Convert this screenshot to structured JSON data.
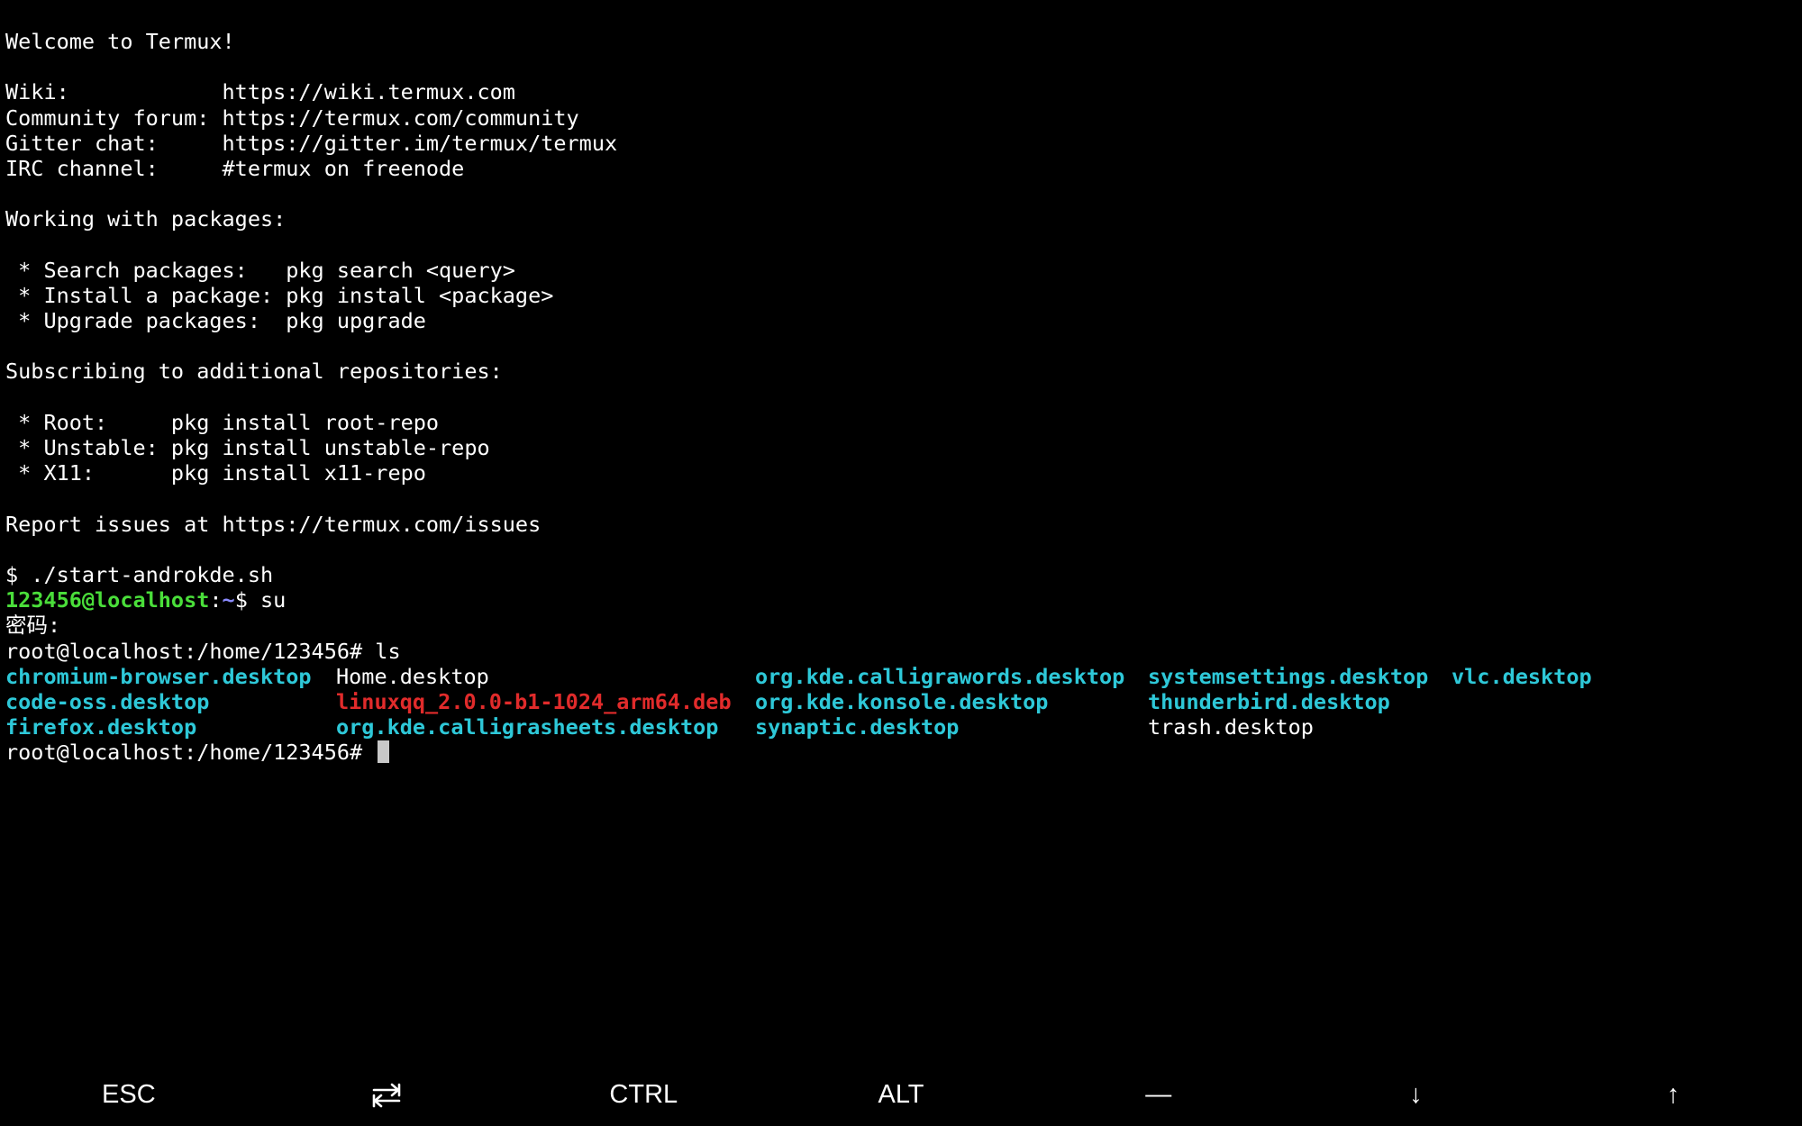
{
  "terminal": {
    "welcome": "Welcome to Termux!",
    "info_lines": [
      "Wiki:            https://wiki.termux.com",
      "Community forum: https://termux.com/community",
      "Gitter chat:     https://gitter.im/termux/termux",
      "IRC channel:     #termux on freenode"
    ],
    "packages_heading": "Working with packages:",
    "package_lines": [
      " * Search packages:   pkg search <query>",
      " * Install a package: pkg install <package>",
      " * Upgrade packages:  pkg upgrade"
    ],
    "repos_heading": "Subscribing to additional repositories:",
    "repo_lines": [
      " * Root:     pkg install root-repo",
      " * Unstable: pkg install unstable-repo",
      " * X11:      pkg install x11-repo"
    ],
    "report": "Report issues at https://termux.com/issues",
    "cmd_start": "$ ./start-androkde.sh",
    "prompt_user": "123456@localhost",
    "prompt_colon": ":",
    "prompt_path": "~",
    "prompt_dollar": "$ su",
    "password_prompt": "密码:",
    "root_ls_cmd": "root@localhost:/home/123456# ls",
    "ls_items": [
      "chromium-browser.desktop",
      "Home.desktop",
      "org.kde.calligrawords.desktop",
      "systemsettings.desktop",
      "vlc.desktop",
      "code-oss.desktop",
      "linuxqq_2.0.0-b1-1024_arm64.deb",
      "org.kde.konsole.desktop",
      "thunderbird.desktop",
      "",
      "firefox.desktop",
      "org.kde.calligrasheets.desktop",
      "synaptic.desktop",
      "trash.desktop",
      ""
    ],
    "final_prompt": "root@localhost:/home/123456# "
  },
  "extra_keys": {
    "esc": "ESC",
    "tab_icon": "tab-arrows-icon",
    "ctrl": "CTRL",
    "alt": "ALT",
    "dash": "—",
    "down": "↓",
    "up": "↑"
  },
  "colors": {
    "background": "#000000",
    "text": "#ffffff",
    "prompt_user": "#4ade3a",
    "prompt_path": "#8a8aff",
    "desktop_file": "#2ec8d8",
    "deb_file": "#e12b2b",
    "cursor": "#c8c8c8"
  }
}
